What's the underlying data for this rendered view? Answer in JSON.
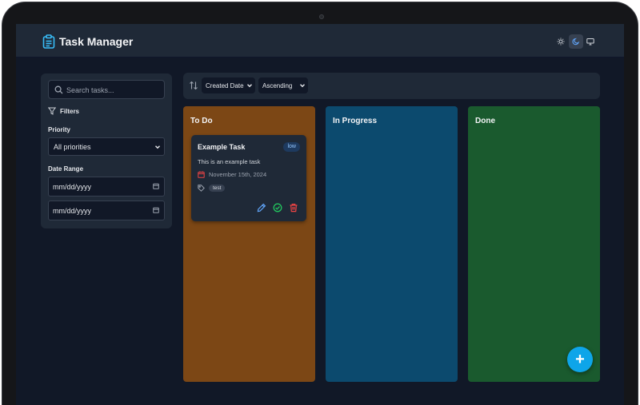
{
  "app": {
    "title": "Task Manager"
  },
  "theme": {
    "options": [
      "light",
      "dark",
      "system"
    ],
    "selected": "dark"
  },
  "search": {
    "placeholder": "Search tasks..."
  },
  "filters": {
    "label": "Filters",
    "priority": {
      "label": "Priority",
      "value": "All priorities"
    },
    "date_range": {
      "label": "Date Range",
      "start_placeholder": "mm/dd/yyyy",
      "end_placeholder": "mm/dd/yyyy"
    }
  },
  "sort": {
    "field": "Created Date",
    "order": "Ascending"
  },
  "columns": [
    {
      "title": "To Do",
      "color": "#7c4715",
      "tasks": [
        {
          "title": "Example Task",
          "priority": "low",
          "description": "This is an example task",
          "date": "November 15th, 2024",
          "tags": [
            "test"
          ]
        }
      ]
    },
    {
      "title": "In Progress",
      "color": "#0c4a6e",
      "tasks": []
    },
    {
      "title": "Done",
      "color": "#1a5a2e",
      "tasks": []
    }
  ],
  "fab": {
    "label": "+"
  },
  "colors": {
    "background": "#111827",
    "panel": "#1f2937",
    "accent": "#0ea5e9",
    "edit": "#60a5fa",
    "complete": "#22c55e",
    "delete": "#ef4444",
    "date_icon": "#ef4444"
  }
}
